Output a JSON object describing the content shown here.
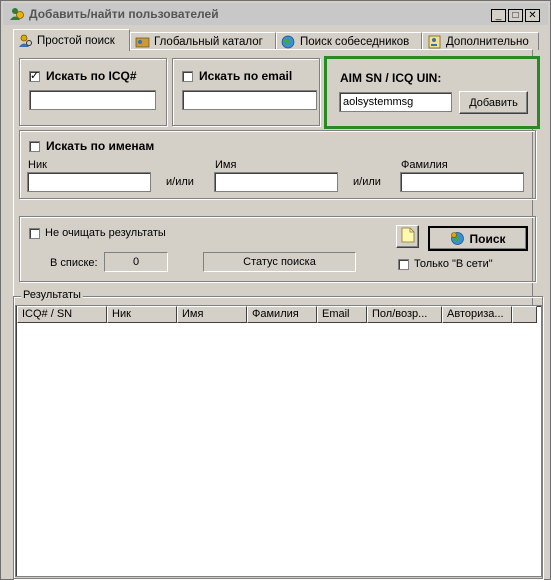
{
  "window": {
    "title": "Добавить/найти пользователей",
    "minimize": "_",
    "maximize": "□",
    "close": "✕"
  },
  "tabs": [
    {
      "label": "Простой поиск",
      "icon": "user-search-icon",
      "active": true
    },
    {
      "label": "Глобальный каталог",
      "icon": "catalog-icon",
      "active": false
    },
    {
      "label": "Поиск собеседников",
      "icon": "globe-icon",
      "active": false
    },
    {
      "label": "Дополнительно",
      "icon": "user-card-icon",
      "active": false
    }
  ],
  "icq_search": {
    "label": "Искать по ICQ#",
    "checked": true,
    "value": ""
  },
  "email_search": {
    "label": "Искать по email",
    "checked": false,
    "value": ""
  },
  "aim": {
    "label": "AIM SN / ICQ UIN:",
    "value": "aolsystemmsg",
    "add_button": "Добавить",
    "highlight_color": "#2a8a22"
  },
  "name_search": {
    "label": "Искать по именам",
    "checked": false,
    "nick_label": "Ник",
    "first_label": "Имя",
    "last_label": "Фамилия",
    "or1": "и/или",
    "or2": "и/или"
  },
  "options": {
    "keep_results_label": "Не очищать результаты",
    "keep_results_checked": false,
    "in_list_label": "В списке:",
    "in_list_value": "0",
    "status": "Статус поиска",
    "search_button": "Поиск",
    "online_only_label": "Только \"В сети\"",
    "online_only_checked": false
  },
  "results": {
    "legend": "Результаты",
    "columns": [
      "ICQ# / SN",
      "Ник",
      "Имя",
      "Фамилия",
      "Email",
      "Пол/возр...",
      "Авториза..."
    ]
  }
}
